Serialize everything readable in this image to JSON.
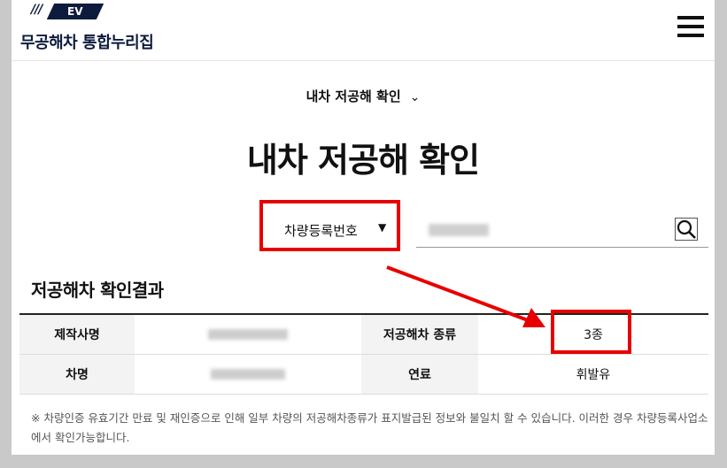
{
  "header": {
    "logo_slashes": "///",
    "logo_text": "EV",
    "site_title": "무공해차 통합누리집"
  },
  "breadcrumb": {
    "label": "내차 저공해 확인",
    "chevron": "⌄"
  },
  "page_title": "내차 저공해 확인",
  "search": {
    "select_value": "차량등록번호",
    "select_arrow": "▼",
    "input_value": ""
  },
  "results": {
    "title": "저공해차 확인결과",
    "rows": [
      {
        "label1": "제작사명",
        "label2": "저공해차 종류",
        "value2": "3종"
      },
      {
        "label1": "차명",
        "label2": "연료",
        "value2": "휘발유"
      }
    ]
  },
  "note": "※ 차량인증 유효기간 만료 및 재인증으로 인해 일부 차량의 저공해차종류가 표지발급된 정보와 불일치 할 수 있습니다. 이러한 경우 차량등록사업소에서 확인가능합니다.",
  "colors": {
    "highlight": "#e80000",
    "brand": "#0d1b3d"
  }
}
